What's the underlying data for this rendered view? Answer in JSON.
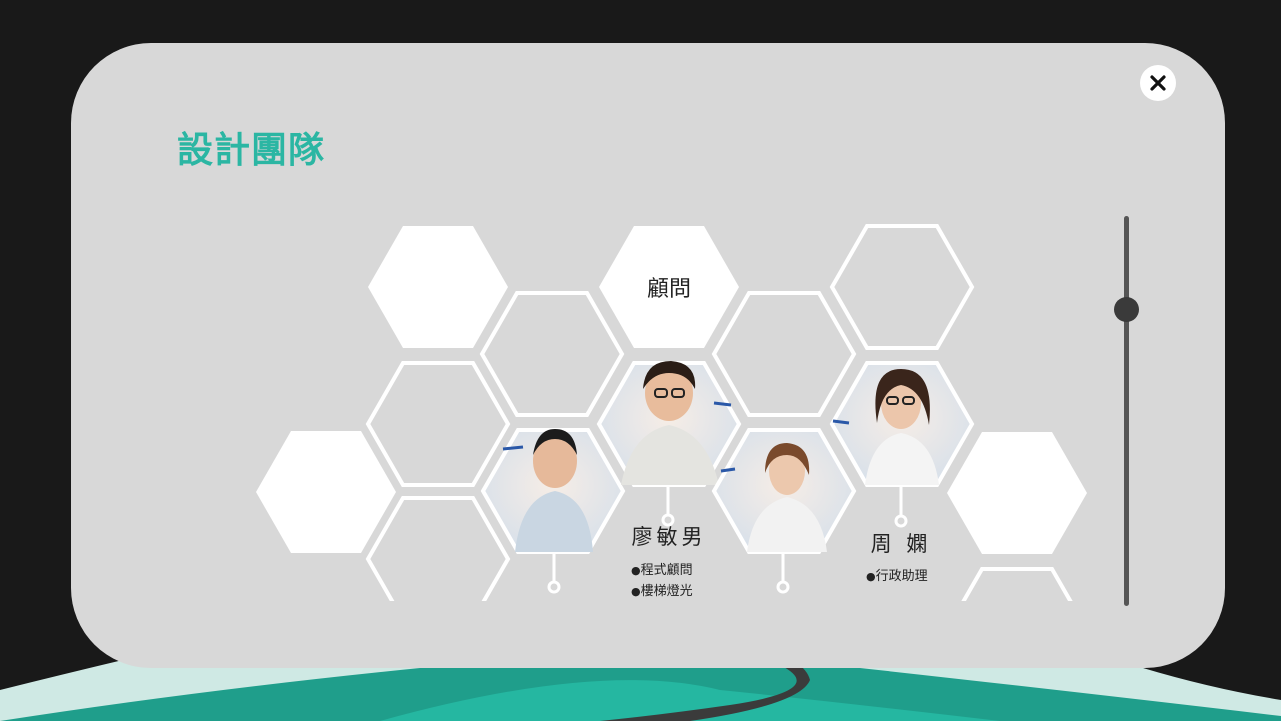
{
  "modal": {
    "title": "設計團隊",
    "close_icon": "close-icon"
  },
  "scroll": {
    "position": 0.24
  },
  "team": {
    "group_label": "顧問",
    "members": [
      {
        "name": "廖敏男",
        "roles": [
          "程式顧問",
          "樓梯燈光"
        ]
      },
      {
        "name": "周 嫻",
        "roles": [
          "行政助理"
        ]
      }
    ]
  },
  "colors": {
    "accent": "#2bb6a3",
    "modal_bg": "#d8d8d8",
    "hex_white": "#ffffff"
  }
}
